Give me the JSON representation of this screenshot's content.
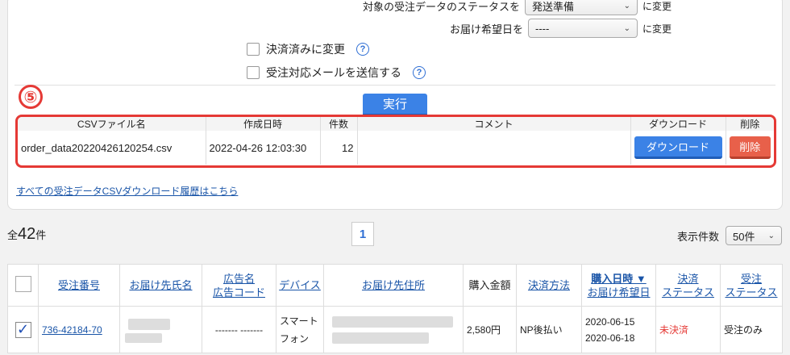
{
  "status_change": {
    "label": "対象の受注データのステータスを",
    "selected": "発送準備",
    "suffix": "に変更"
  },
  "delivery_date": {
    "label": "お届け希望日を",
    "selected": "----",
    "suffix": "に変更"
  },
  "options": [
    {
      "label": "決済済みに変更",
      "checked": false
    },
    {
      "label": "受注対応メールを送信する",
      "checked": false
    }
  ],
  "step_badge": "⑤",
  "execute_label": "実行",
  "csv_table": {
    "headers": [
      "CSVファイル名",
      "作成日時",
      "件数",
      "コメント",
      "ダウンロード",
      "削除"
    ],
    "row": {
      "filename": "order_data20220426120254.csv",
      "created": "2022-04-26 12:03:30",
      "count": "12",
      "comment": "",
      "download_label": "ダウンロード",
      "delete_label": "削除"
    }
  },
  "history_link": "すべての受注データCSVダウンロード履歴はこちら",
  "total": {
    "prefix": "全",
    "number": "42",
    "suffix": "件"
  },
  "pager": {
    "current": "1"
  },
  "per_page": {
    "label": "表示件数",
    "selected": "50件"
  },
  "orders": {
    "headers": {
      "order_no": "受注番号",
      "recipient": "お届け先氏名",
      "ad_line1": "広告名",
      "ad_line2": "広告コード",
      "device": "デバイス",
      "address": "お届け先住所",
      "amount": "購入金額",
      "payment": "決済方法",
      "date_line1": "購入日時 ▼",
      "date_line2": "お届け希望日",
      "pay_status_line1": "決済",
      "pay_status_line2": "ステータス",
      "order_status_line1": "受注",
      "order_status_line2": "ステータス"
    },
    "rows": [
      {
        "checked": true,
        "order_no": "736-42184-70",
        "ad": "------- -------",
        "device_line1": "スマート",
        "device_line2": "フォン",
        "amount": "2,580円",
        "payment": "NP後払い",
        "purchase_date": "2020-06-15",
        "delivery_date": "2020-06-18",
        "pay_status": "未決済",
        "order_status": "受注のみ"
      }
    ]
  },
  "colors": {
    "accent_blue": "#3b82e6",
    "danger_red": "#e53935",
    "delete_button": "#e8604a",
    "link": "#1a55a8"
  }
}
